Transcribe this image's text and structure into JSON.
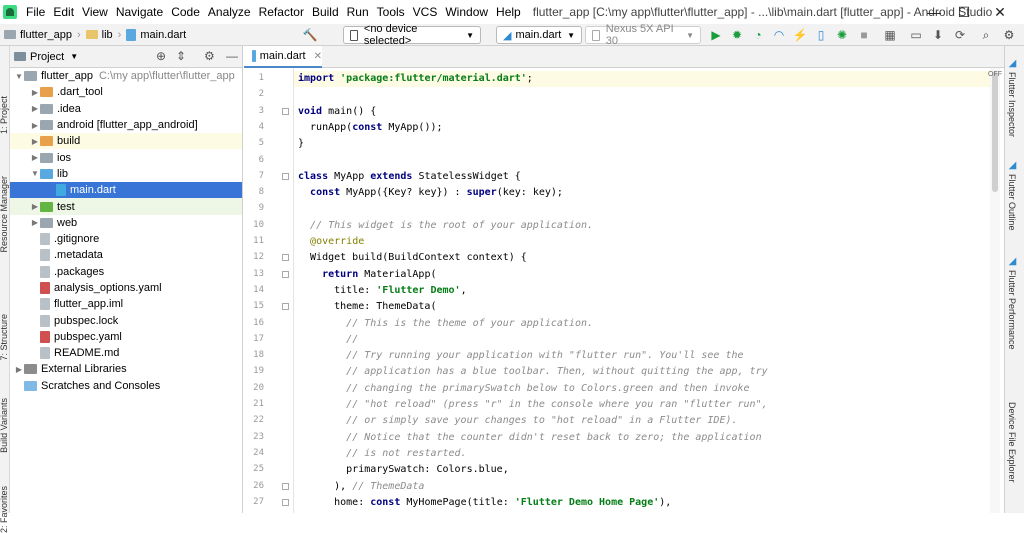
{
  "window": {
    "title": "flutter_app [C:\\my app\\flutter\\flutter_app] - ...\\lib\\main.dart [flutter_app] - Android Studio",
    "minimize": "—",
    "maximize": "☐",
    "close": "✕"
  },
  "menu": [
    "File",
    "Edit",
    "View",
    "Navigate",
    "Code",
    "Analyze",
    "Refactor",
    "Build",
    "Run",
    "Tools",
    "VCS",
    "Window",
    "Help"
  ],
  "breadcrumb": {
    "project": "flutter_app",
    "folder": "lib",
    "file": "main.dart"
  },
  "toolbar": {
    "device_selector": "<no device selected>",
    "run_config": "main.dart",
    "emulator": "Nexus 5X API 30"
  },
  "left_strip": {
    "project": "1: Project",
    "resource": "Resource Manager",
    "structure": "7: Structure",
    "build_variants": "Build Variants",
    "favorites": "2: Favorites"
  },
  "project_panel": {
    "title": "Project",
    "tree": [
      {
        "label": "flutter_app",
        "hint": "C:\\my app\\flutter\\flutter_app",
        "depth": 0,
        "arrow": "▼",
        "icon": "folder"
      },
      {
        "label": ".dart_tool",
        "depth": 1,
        "arrow": "▶",
        "icon": "folder-orange"
      },
      {
        "label": ".idea",
        "depth": 1,
        "arrow": "▶",
        "icon": "folder"
      },
      {
        "label": "android [flutter_app_android]",
        "depth": 1,
        "arrow": "▶",
        "icon": "folder"
      },
      {
        "label": "build",
        "depth": 1,
        "arrow": "▶",
        "icon": "folder-orange",
        "row": "yel"
      },
      {
        "label": "ios",
        "depth": 1,
        "arrow": "▶",
        "icon": "folder"
      },
      {
        "label": "lib",
        "depth": 1,
        "arrow": "▼",
        "icon": "folder-blue"
      },
      {
        "label": "main.dart",
        "depth": 2,
        "arrow": "",
        "icon": "dart",
        "row": "sel"
      },
      {
        "label": "test",
        "depth": 1,
        "arrow": "▶",
        "icon": "folder-green",
        "row": "grn"
      },
      {
        "label": "web",
        "depth": 1,
        "arrow": "▶",
        "icon": "folder"
      },
      {
        "label": ".gitignore",
        "depth": 1,
        "arrow": "",
        "icon": "file"
      },
      {
        "label": ".metadata",
        "depth": 1,
        "arrow": "",
        "icon": "file"
      },
      {
        "label": ".packages",
        "depth": 1,
        "arrow": "",
        "icon": "file"
      },
      {
        "label": "analysis_options.yaml",
        "depth": 1,
        "arrow": "",
        "icon": "yaml"
      },
      {
        "label": "flutter_app.iml",
        "depth": 1,
        "arrow": "",
        "icon": "file"
      },
      {
        "label": "pubspec.lock",
        "depth": 1,
        "arrow": "",
        "icon": "file"
      },
      {
        "label": "pubspec.yaml",
        "depth": 1,
        "arrow": "",
        "icon": "yaml"
      },
      {
        "label": "README.md",
        "depth": 1,
        "arrow": "",
        "icon": "file"
      },
      {
        "label": "External Libraries",
        "depth": 0,
        "arrow": "▶",
        "icon": "lib"
      },
      {
        "label": "Scratches and Consoles",
        "depth": 0,
        "arrow": "",
        "icon": "scratch"
      }
    ]
  },
  "editor": {
    "tab": "main.dart",
    "off_label": "OFF",
    "lines": [
      "<span class=\"kw\">import</span> <span class=\"st\">'package:flutter/material.dart'</span>;",
      "",
      "<span class=\"kw\">void</span> main() {",
      "  runApp(<span class=\"kw\">const</span> MyApp());",
      "}",
      "",
      "<span class=\"kw\">class</span> MyApp <span class=\"kw\">extends</span> StatelessWidget {",
      "  <span class=\"kw\">const</span> MyApp({Key? key}) : <span class=\"kw\">super</span>(key: key);",
      "",
      "  <span class=\"cm\">// This widget is the root of your application.</span>",
      "  <span class=\"an\">@override</span>",
      "  Widget build(BuildContext context) {",
      "    <span class=\"kw\">return</span> MaterialApp(",
      "      title: <span class=\"st\">'Flutter Demo'</span>,",
      "      theme: ThemeData(",
      "        <span class=\"cm\">// This is the theme of your application.</span>",
      "        <span class=\"cm\">//</span>",
      "        <span class=\"cm\">// Try running your application with \"flutter run\". You'll see the</span>",
      "        <span class=\"cm\">// application has a blue toolbar. Then, without quitting the app, try</span>",
      "        <span class=\"cm\">// changing the primarySwatch below to Colors.green and then invoke</span>",
      "        <span class=\"cm\">// \"hot reload\" (press \"r\" in the console where you ran \"flutter run\",</span>",
      "        <span class=\"cm\">// or simply save your changes to \"hot reload\" in a Flutter IDE).</span>",
      "        <span class=\"cm\">// Notice that the counter didn't reset back to zero; the application</span>",
      "        <span class=\"cm\">// is not restarted.</span>",
      "        primarySwatch: Colors.blue,",
      "      ), <span class=\"cm\">// ThemeData</span>",
      "      home: <span class=\"kw\">const</span> MyHomePage(title: <span class=\"st\">'Flutter Demo Home Page'</span>),"
    ]
  },
  "right_strip": {
    "inspector": "Flutter Inspector",
    "outline": "Flutter Outline",
    "performance": "Flutter Performance",
    "device_explorer": "Device File Explorer"
  },
  "colors": {
    "selection": "#3875d7",
    "keyword": "#000080",
    "string": "#067d17",
    "comment": "#8c8c8c"
  }
}
